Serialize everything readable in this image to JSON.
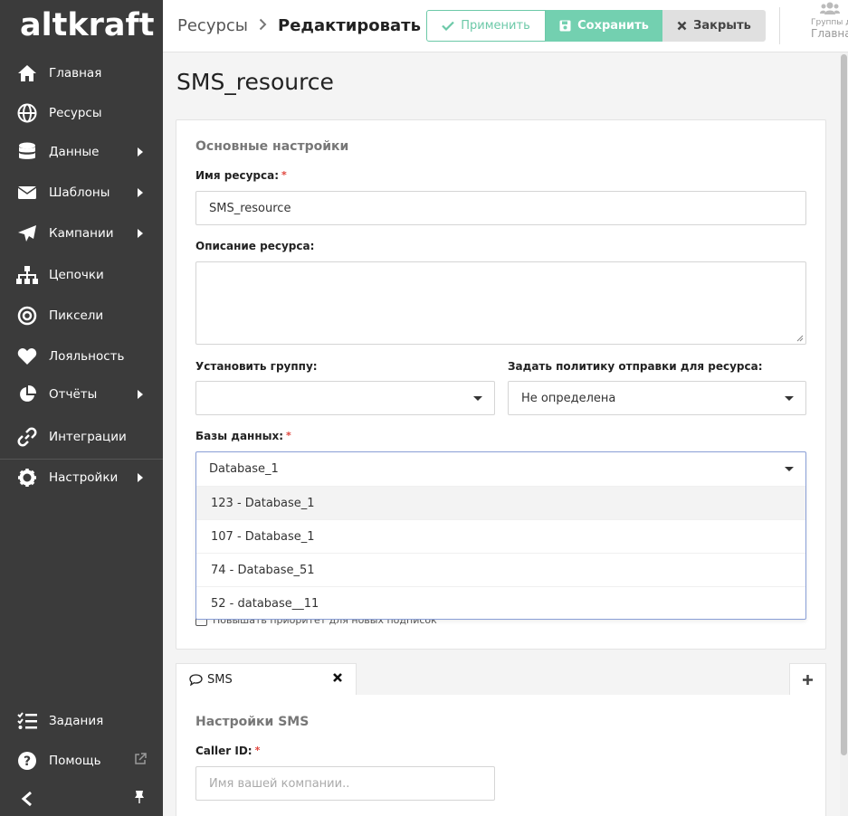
{
  "sidebar": {
    "logo": "altkraft",
    "items": [
      {
        "label": "Главная",
        "icon": "home-icon"
      },
      {
        "label": "Ресурсы",
        "icon": "globe-icon"
      },
      {
        "label": "Данные",
        "icon": "database-icon"
      },
      {
        "label": "Шаблоны",
        "icon": "envelope-icon"
      },
      {
        "label": "Кампании",
        "icon": "paper-plane-icon"
      },
      {
        "label": "Цепочки",
        "icon": "sitemap-icon"
      },
      {
        "label": "Пиксели",
        "icon": "target-icon"
      },
      {
        "label": "Лояльность",
        "icon": "heart-icon"
      },
      {
        "label": "Отчёты",
        "icon": "pie-chart-icon"
      },
      {
        "label": "Интеграции",
        "icon": "link-icon"
      },
      {
        "label": "Настройки",
        "icon": "gear-icon"
      }
    ],
    "bottom": [
      {
        "label": "Задания",
        "icon": "tasks-icon"
      },
      {
        "label": "Помощь",
        "icon": "question-icon"
      }
    ]
  },
  "header": {
    "breadcrumb_parent": "Ресурсы",
    "breadcrumb_current": "Редактировать",
    "apply_label": "Применить",
    "save_label": "Сохранить",
    "close_label": "Закрыть",
    "groups_label": "Группы д",
    "groups_value": "Главна"
  },
  "main": {
    "page_title": "SMS_resource",
    "section_title": "Основные настройки",
    "resource_name_label": "Имя ресурса:",
    "resource_name_value": "SMS_resource",
    "description_label": "Описание ресурса:",
    "group_label": "Установить группу:",
    "policy_label": "Задать политику отправки для ресурса:",
    "policy_value": "Не определена",
    "databases_label": "Базы данных:",
    "databases_value": "Database_1",
    "database_options": [
      "123 - Database_1",
      "107 - Database_1",
      "74 - Database_51",
      "52 - database__11"
    ],
    "priority_checkbox_label": "Повышать приоритет для новых подписок",
    "required_mark": "*"
  },
  "tabs": {
    "sms_tab_label": "SMS",
    "sms_settings_title": "Настройки SMS",
    "caller_id_label": "Caller ID:",
    "caller_id_placeholder": "Имя вашей компании.."
  },
  "colors": {
    "sidebar_bg": "#3b3b3b",
    "accent": "#73d0b0",
    "required": "#e0443b"
  }
}
